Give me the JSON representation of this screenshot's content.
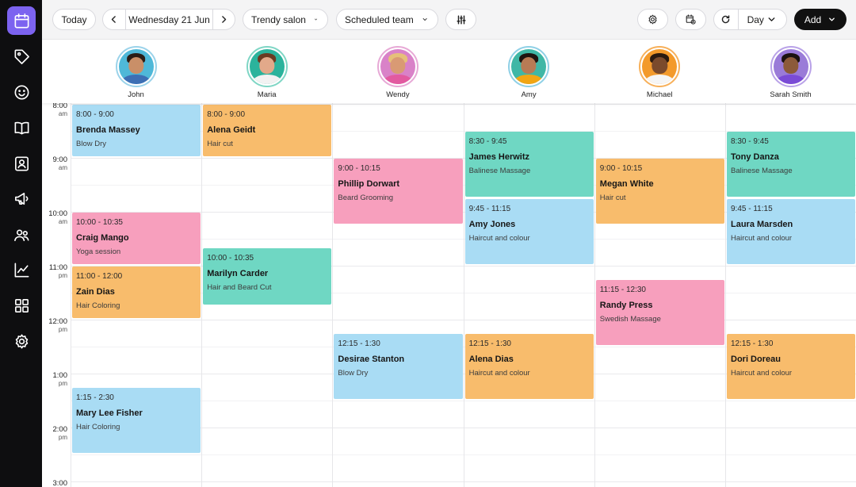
{
  "toolbar": {
    "today_label": "Today",
    "date_label": "Wednesday 21 Jun",
    "location_label": "Trendy salon",
    "team_label": "Scheduled team",
    "view_label": "Day",
    "add_label": "Add"
  },
  "staff": [
    {
      "name": "John",
      "skin": "#c98f68",
      "hair": "#2b1d16",
      "shirt": "#3d6fb4",
      "bg": "#4fb8d8"
    },
    {
      "name": "Maria",
      "skin": "#e2a98a",
      "hair": "#6b3b22",
      "shirt": "#f2f2f2",
      "bg": "#2bb39c"
    },
    {
      "name": "Wendy",
      "skin": "#d99a74",
      "hair": "#e6c07a",
      "shirt": "#e25aa0",
      "bg": "#d982c8"
    },
    {
      "name": "Amy",
      "skin": "#b87b55",
      "hair": "#1e1410",
      "shirt": "#f2a614",
      "bg": "#3fb7a6"
    },
    {
      "name": "Michael",
      "skin": "#7a4a2c",
      "hair": "#2a1a10",
      "shirt": "#f5f5f5",
      "bg": "#f39a2b"
    },
    {
      "name": "Sarah Smith",
      "skin": "#8c5a3a",
      "hair": "#1b1210",
      "shirt": "#7a4bd6",
      "bg": "#9a7bd8"
    }
  ],
  "time_labels": [
    {
      "hour": "8:00",
      "ampm": "am"
    },
    {
      "hour": "9:00",
      "ampm": "am"
    },
    {
      "hour": "10:00",
      "ampm": "am"
    },
    {
      "hour": "11:00",
      "ampm": "pm"
    },
    {
      "hour": "12:00",
      "ampm": "pm"
    },
    {
      "hour": "1:00",
      "ampm": "pm"
    },
    {
      "hour": "2:00",
      "ampm": "pm"
    },
    {
      "hour": "3:00",
      "ampm": ""
    }
  ],
  "appointments": [
    {
      "staff": 0,
      "start": 8.0,
      "end": 9.0,
      "time": "8:00 - 9:00",
      "client": "Brenda Massey",
      "service": "Blow Dry",
      "color": "blue"
    },
    {
      "staff": 0,
      "start": 10.0,
      "end": 11.0,
      "time": "10:00 - 10:35",
      "client": "Craig Mango",
      "service": "Yoga session",
      "color": "pink"
    },
    {
      "staff": 0,
      "start": 11.0,
      "end": 12.0,
      "time": "11:00 - 12:00",
      "client": "Zain Dias",
      "service": "Hair Coloring",
      "color": "orange"
    },
    {
      "staff": 0,
      "start": 13.25,
      "end": 14.5,
      "time": "1:15 - 2:30",
      "client": "Mary Lee Fisher",
      "service": "Hair Coloring",
      "color": "blue"
    },
    {
      "staff": 1,
      "start": 8.0,
      "end": 9.0,
      "time": "8:00 - 9:00",
      "client": "Alena Geidt",
      "service": "Hair cut",
      "color": "orange"
    },
    {
      "staff": 1,
      "start": 10.6667,
      "end": 11.75,
      "time": "10:00 - 10:35",
      "client": "Marilyn Carder",
      "service": "Hair and Beard Cut",
      "color": "teal"
    },
    {
      "staff": 2,
      "start": 9.0,
      "end": 10.25,
      "time": "9:00 - 10:15",
      "client": "Phillip Dorwart",
      "service": "Beard Grooming",
      "color": "pink"
    },
    {
      "staff": 2,
      "start": 12.25,
      "end": 13.5,
      "time": "12:15 - 1:30",
      "client": "Desirae Stanton",
      "service": "Blow Dry",
      "color": "blue"
    },
    {
      "staff": 3,
      "start": 8.5,
      "end": 9.75,
      "time": "8:30 - 9:45",
      "client": "James Herwitz",
      "service": "Balinese Massage",
      "color": "teal"
    },
    {
      "staff": 3,
      "start": 9.75,
      "end": 11.0,
      "time": "9:45 - 11:15",
      "client": "Amy Jones",
      "service": "Haircut and colour",
      "color": "blue"
    },
    {
      "staff": 3,
      "start": 12.25,
      "end": 13.5,
      "time": "12:15 - 1:30",
      "client": "Alena Dias",
      "service": "Haircut and colour",
      "color": "orange"
    },
    {
      "staff": 4,
      "start": 9.0,
      "end": 10.25,
      "time": "9:00 - 10:15",
      "client": "Megan White",
      "service": "Hair cut",
      "color": "orange"
    },
    {
      "staff": 4,
      "start": 11.25,
      "end": 12.5,
      "time": "11:15 - 12:30",
      "client": "Randy Press",
      "service": "Swedish Massage",
      "color": "pink"
    },
    {
      "staff": 5,
      "start": 8.5,
      "end": 9.75,
      "time": "8:30 - 9:45",
      "client": "Tony Danza",
      "service": "Balinese Massage",
      "color": "teal"
    },
    {
      "staff": 5,
      "start": 9.75,
      "end": 11.0,
      "time": "9:45 - 11:15",
      "client": "Laura Marsden",
      "service": "Haircut and colour",
      "color": "blue"
    },
    {
      "staff": 5,
      "start": 12.25,
      "end": 13.5,
      "time": "12:15 - 1:30",
      "client": "Dori Doreau",
      "service": "Haircut and colour",
      "color": "orange"
    }
  ],
  "sidebar_icons": [
    "calendar-icon",
    "tag-icon",
    "smiley-icon",
    "book-icon",
    "contact-card-icon",
    "megaphone-icon",
    "team-icon",
    "analytics-icon",
    "apps-grid-icon",
    "settings-icon"
  ]
}
